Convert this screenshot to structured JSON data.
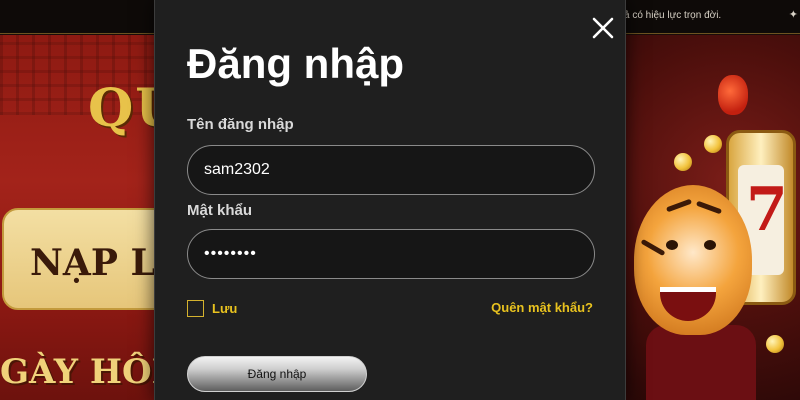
{
  "background": {
    "marquee_text": "ả có hiệu lực trọn đời.",
    "banner_heading": "QU",
    "promo_text": "NẠP LẦ",
    "bottom_text": "GÀY HÔM"
  },
  "login_modal": {
    "title": "Đăng nhập",
    "username": {
      "label": "Tên đăng nhập",
      "value": "sam2302"
    },
    "password": {
      "label": "Mật khẩu",
      "value": "••••••••"
    },
    "remember": {
      "label": "Lưu",
      "checked": false
    },
    "forgot_password": "Quên mật khẩu?",
    "submit_label": "Đăng nhập"
  },
  "colors": {
    "modal_bg": "#1f1f1f",
    "accent_yellow": "#e8c21f",
    "text_white": "#ffffff"
  },
  "icons": {
    "close": "close-icon",
    "corner": "sparkle-icon"
  }
}
